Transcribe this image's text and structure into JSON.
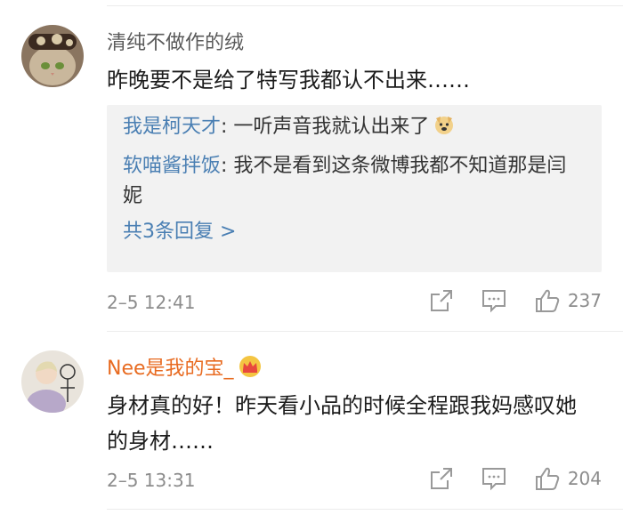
{
  "comments": [
    {
      "username": "清纯不做作的绒",
      "text": "昨晚要不是给了特写我都认不出来……",
      "replies": [
        {
          "user": "我是柯天才",
          "text": ": 一听声音我就认出来了"
        },
        {
          "user": "软喵酱拌饭",
          "text": ": 我不是看到这条微博我都不知道那是闫妮"
        }
      ],
      "more_replies": "共3条回复 >",
      "time": "2–5 12:41",
      "likes": "237"
    },
    {
      "username": "Nee是我的宝_",
      "text": "身材真的好！昨天看小品的时候全程跟我妈感叹她的身材……",
      "time": "2–5 13:31",
      "likes": "204"
    }
  ],
  "colors": {
    "link_blue": "#4a7fb3",
    "vip_orange": "#e86b21",
    "meta_gray": "#8c8c8c",
    "reply_bg": "#f2f2f2"
  },
  "icons": [
    "share-icon",
    "comment-icon",
    "like-icon",
    "dog-emoji-icon",
    "crown-badge-icon"
  ]
}
